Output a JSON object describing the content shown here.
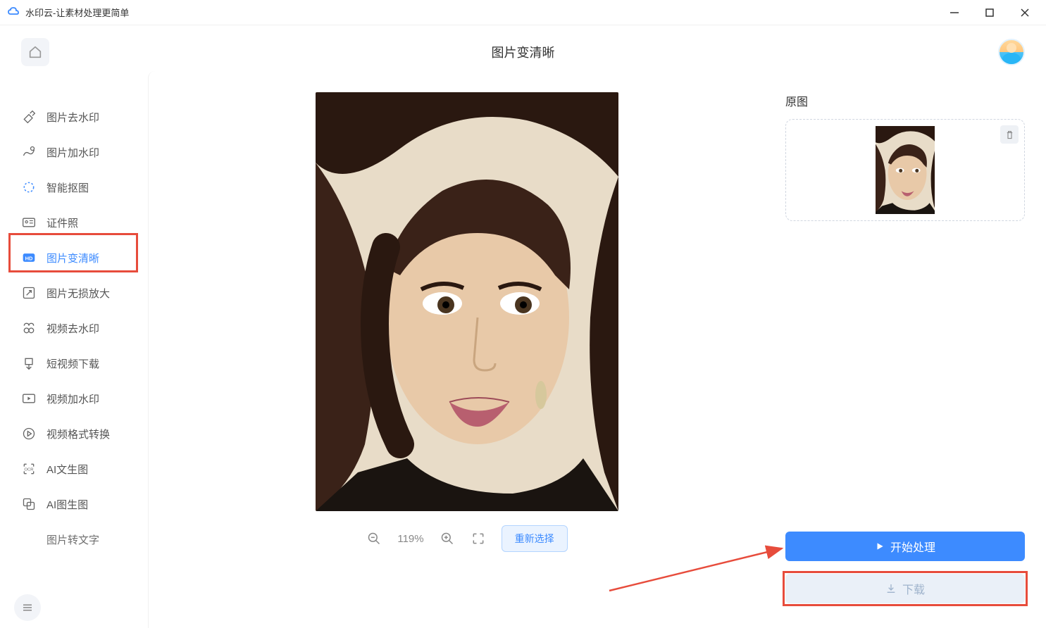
{
  "app": {
    "title": "水印云-让素材处理更简单"
  },
  "header": {
    "page_title": "图片变清晰"
  },
  "sidebar": {
    "items": [
      {
        "label": "图片去水印"
      },
      {
        "label": "图片加水印"
      },
      {
        "label": "智能抠图"
      },
      {
        "label": "证件照"
      },
      {
        "label": "图片变清晰"
      },
      {
        "label": "图片无损放大"
      },
      {
        "label": "视频去水印"
      },
      {
        "label": "短视频下载"
      },
      {
        "label": "视频加水印"
      },
      {
        "label": "视频格式转换"
      },
      {
        "label": "AI文生图"
      },
      {
        "label": "AI图生图"
      },
      {
        "label": "图片转文字"
      }
    ]
  },
  "preview": {
    "zoom": "119%",
    "reselect_label": "重新选择"
  },
  "right_panel": {
    "original_label": "原图",
    "start_label": "开始处理",
    "download_label": "下载"
  }
}
